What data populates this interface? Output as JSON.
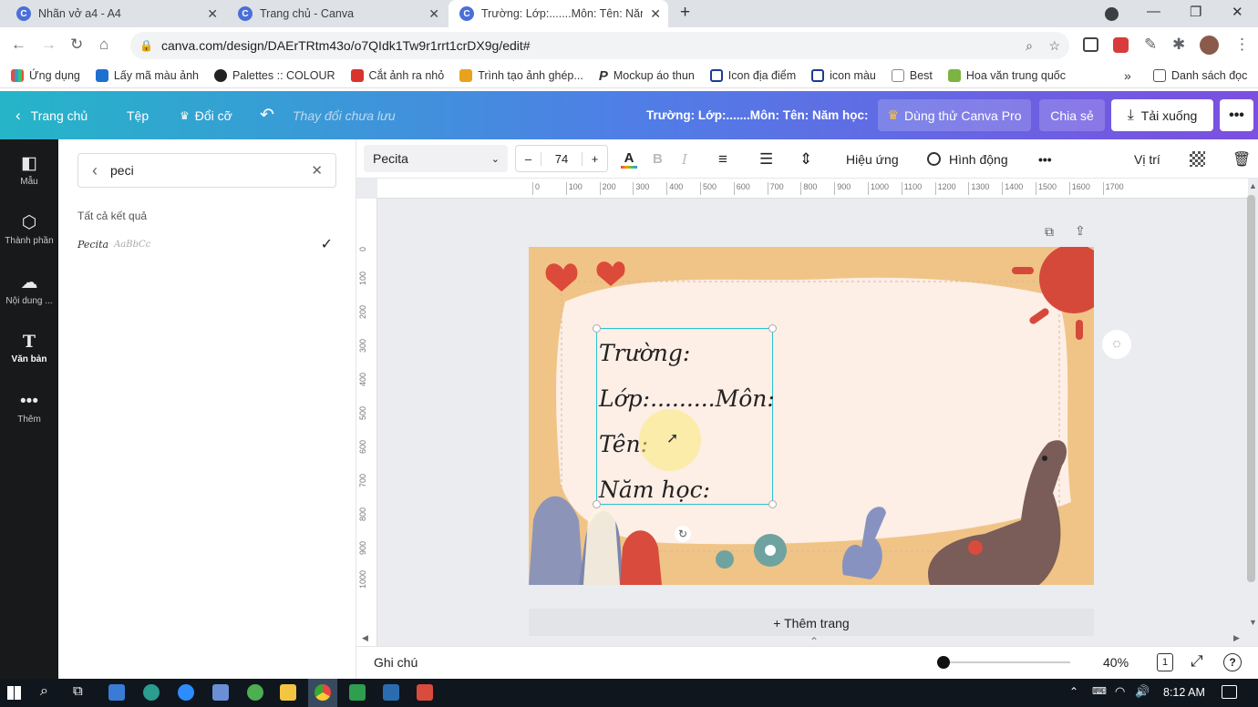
{
  "browser": {
    "tabs": [
      {
        "title": "Nhãn vở a4 - A4",
        "active": false
      },
      {
        "title": "Trang chủ - Canva",
        "active": false
      },
      {
        "title": "Trường: Lớp:.......Môn: Tên: Năm học:",
        "active": true
      }
    ],
    "url": "canva.com/design/DAErTRtm43o/o7QIdk1Tw9r1rrt1crDX9g/edit#",
    "bookmarks": [
      "Ứng dụng",
      "Lấy mã màu ảnh",
      "Palettes :: COLOUR",
      "Cắt ảnh ra nhỏ",
      "Trình tạo ảnh ghép...",
      "Mockup áo thun",
      "Icon địa điểm",
      "icon màu",
      "Best",
      "Hoa văn trung quốc"
    ],
    "bookmarks_more": "»",
    "reading_list": "Danh sách đọc"
  },
  "header": {
    "home": "Trang chủ",
    "file": "Tệp",
    "resize": "Đổi cỡ",
    "unsaved": "Thay đổi chưa lưu",
    "doc_title": "Trường: Lớp:.......Môn: Tên: Năm học:",
    "try_pro": "Dùng thử Canva Pro",
    "share": "Chia sẻ",
    "download": "Tải xuống"
  },
  "rail": [
    {
      "label": "Mẫu",
      "icon": "template-icon"
    },
    {
      "label": "Thành phần",
      "icon": "elements-icon"
    },
    {
      "label": "Nội dung ...",
      "icon": "upload-icon"
    },
    {
      "label": "Văn bản",
      "icon": "text-icon"
    },
    {
      "label": "Thêm",
      "icon": "more-icon"
    }
  ],
  "panel": {
    "search_value": "peci",
    "results_heading": "Tất cả kết quả",
    "font_result": "Pecita",
    "font_sample": "AaBbCc"
  },
  "toolbar": {
    "font": "Pecita",
    "size": "74",
    "minus": "–",
    "plus": "+",
    "effects": "Hiệu ứng",
    "animate": "Hình động",
    "position": "Vị trí"
  },
  "ruler": {
    "h_ticks": [
      "0",
      "100",
      "200",
      "300",
      "400",
      "500",
      "600",
      "700",
      "800",
      "900",
      "1000",
      "1100",
      "1200",
      "1300",
      "1400",
      "1500",
      "1600",
      "1700"
    ],
    "v_ticks": [
      "0",
      "100",
      "200",
      "300",
      "400",
      "500",
      "600",
      "700",
      "800",
      "900",
      "1000"
    ]
  },
  "design": {
    "lines": [
      "Trường:",
      "Lớp:.........Môn:",
      "Tên:",
      "Năm học:"
    ]
  },
  "add_page": "+ Thêm trang",
  "footer": {
    "notes": "Ghi chú",
    "zoom": "40%",
    "page": "1",
    "zoom_level": 0.4
  },
  "taskbar": {
    "time": "8:12 AM"
  },
  "colors": {
    "canva_gradient_start": "#25b5c8",
    "canva_gradient_end": "#7c4fe0",
    "design_bg": "#f0c486",
    "design_inner": "#fdeee6",
    "selection": "#26c4d4"
  }
}
